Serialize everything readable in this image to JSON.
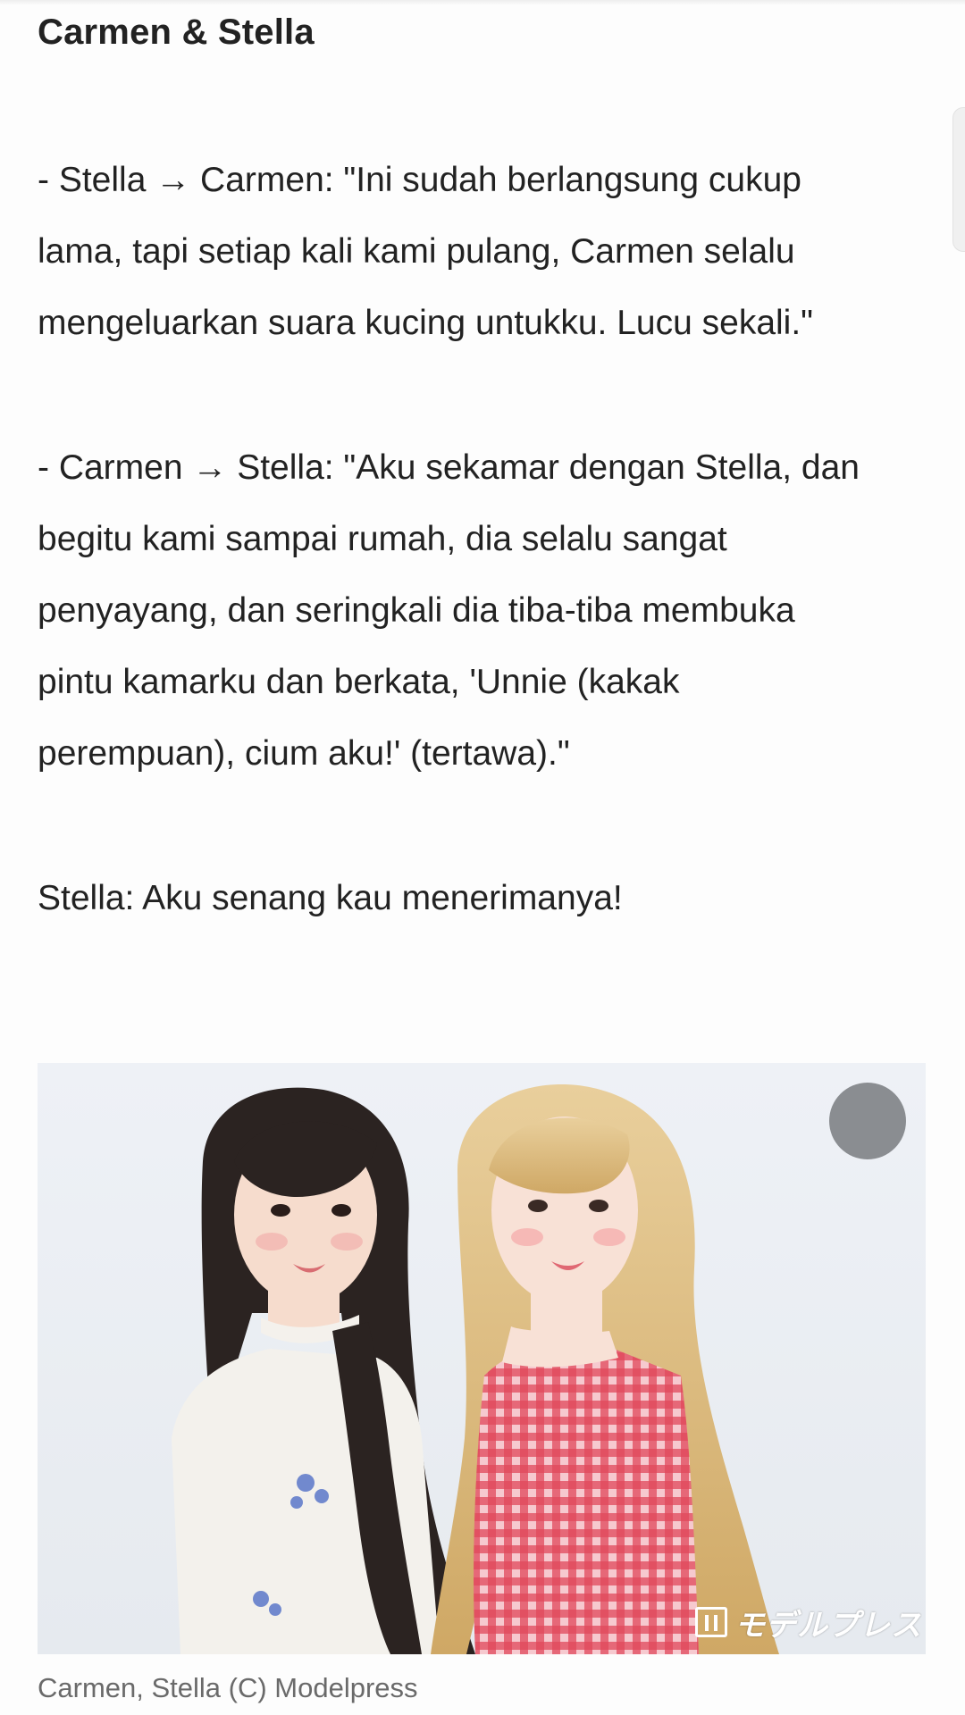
{
  "article": {
    "section_title": "Carmen & Stella",
    "paragraph_1": [
      "- Stella → Carmen: \"Ini sudah berlangsung cukup",
      "lama, tapi setiap kali kami pulang, Carmen selalu",
      "mengeluarkan suara kucing untukku. Lucu sekali.\""
    ],
    "paragraph_2": [
      "- Carmen → Stella: \"Aku sekamar dengan Stella, dan",
      "begitu kami sampai rumah, dia selalu sangat",
      "penyayang, dan seringkali dia tiba-tiba membuka",
      "pintu kamarku dan berkata, 'Unnie (kakak",
      "perempuan), cium aku!' (tertawa).\""
    ],
    "paragraph_3": [
      "Stella: Aku senang kau menerimanya!"
    ]
  },
  "figure": {
    "watermark": "モデルプレス",
    "caption": "Carmen, Stella (C) Modelpress"
  },
  "colors": {
    "text": "#222222",
    "caption": "#6a6a6a",
    "photo_background": "#eef1f5",
    "badge": "#8a8d91",
    "dress_red": "#e0485a"
  }
}
